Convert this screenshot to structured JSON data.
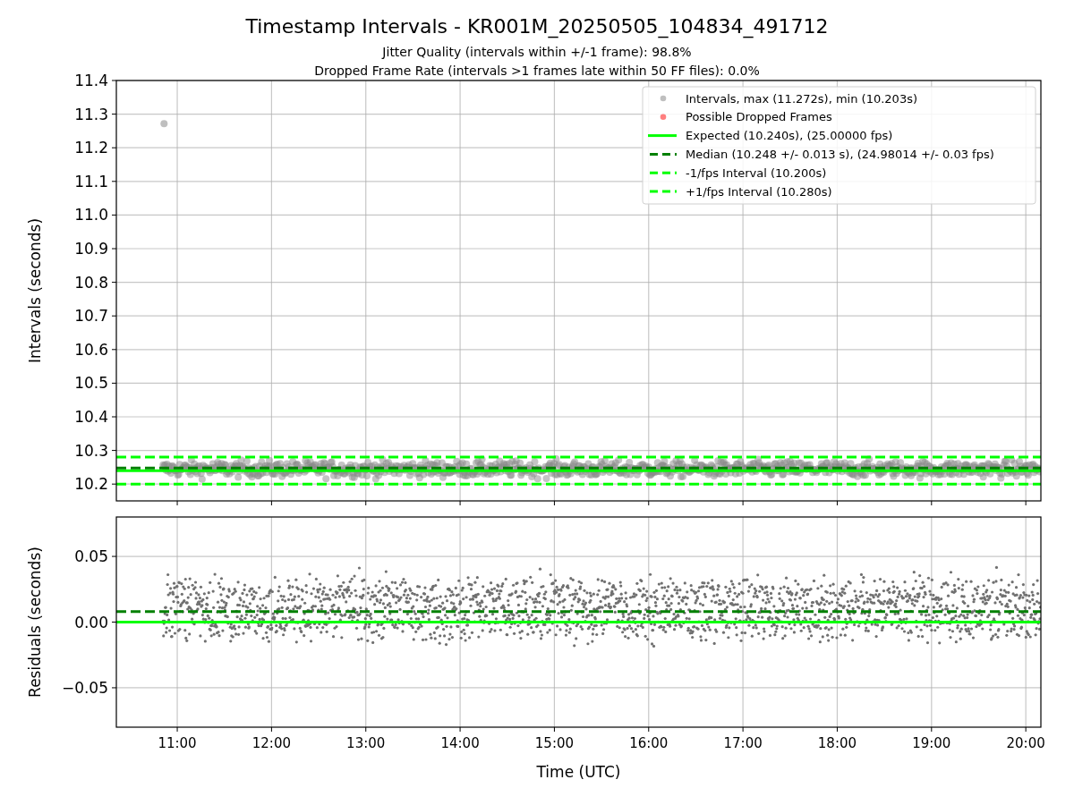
{
  "figure": {
    "title": "Timestamp Intervals - KR001M_20250505_104834_491712",
    "subtitles": [
      "Jitter Quality (intervals within +/-1 frame): 98.8%",
      "Dropped Frame Rate (intervals >1 frames late within 50 FF files): 0.0%"
    ]
  },
  "intervals_plot": {
    "chart_data": {
      "type": "scatter",
      "ylabel": "Intervals (seconds)",
      "grid": true,
      "legend": "upper right",
      "x": [
        10.354,
        10.86,
        20.16
      ],
      "xlim": [
        10.354,
        20.16
      ],
      "ylim": [
        10.15,
        11.4
      ],
      "yticks": [
        {
          "value": 10.2,
          "label": "10.2"
        },
        {
          "value": 10.3,
          "label": "10.3"
        },
        {
          "value": 10.4,
          "label": "10.4"
        },
        {
          "value": 10.5,
          "label": "10.5"
        },
        {
          "value": 10.6,
          "label": "10.6"
        },
        {
          "value": 10.7,
          "label": "10.7"
        },
        {
          "value": 10.8,
          "label": "10.8"
        },
        {
          "value": 10.9,
          "label": "10.9"
        },
        {
          "value": 11,
          "label": "11.0"
        },
        {
          "value": 11.1,
          "label": "11.1"
        },
        {
          "value": 11.2,
          "label": "11.2"
        },
        {
          "value": 11.3,
          "label": "11.3"
        },
        {
          "value": 11.4,
          "label": "11.4"
        }
      ],
      "series": [
        {
          "name": "Intervals, max (11.272s), min (10.203s)",
          "color": "#808080",
          "type": "scatter",
          "values": [
            null,
            11.272,
            null
          ]
        },
        {
          "name": "Possible Dropped Frames",
          "color": "#ff0000",
          "type": "scatter",
          "values": [
            null,
            null,
            null
          ]
        },
        {
          "name": "Expected (10.240s), (25.00000 fps)",
          "color": "#00ff00",
          "type": "line",
          "values": [
            10.24,
            10.24,
            10.24
          ]
        },
        {
          "name": "Median (10.248 +/- 0.013 s), (24.98014 +/- 0.03 fps)",
          "color": "#008000",
          "type": "line",
          "line_style": "dashed",
          "values": [
            10.248,
            10.248,
            10.248
          ]
        },
        {
          "name": "-1/fps Interval (10.200s)",
          "color": "#00ff00",
          "type": "line",
          "line_style": "dashed",
          "values": [
            10.2,
            10.2,
            10.2
          ]
        },
        {
          "name": "+1/fps Interval (10.280s)",
          "color": "#00ff00",
          "type": "line",
          "line_style": "dashed",
          "values": [
            10.28,
            10.28,
            10.28
          ]
        }
      ]
    }
  },
  "residuals_plot": {
    "chart_data": {
      "type": "scatter",
      "xlabel": "Time (UTC)",
      "ylabel": "Residuals (seconds)",
      "grid": true,
      "x": [
        10.354,
        20.16
      ],
      "xlim": [
        10.354,
        20.16
      ],
      "ylim": [
        -0.08,
        0.08
      ],
      "xticks": [
        {
          "value": 11,
          "label": "11:00"
        },
        {
          "value": 12,
          "label": "12:00"
        },
        {
          "value": 13,
          "label": "13:00"
        },
        {
          "value": 14,
          "label": "14:00"
        },
        {
          "value": 15,
          "label": "15:00"
        },
        {
          "value": 16,
          "label": "16:00"
        },
        {
          "value": 17,
          "label": "17:00"
        },
        {
          "value": 18,
          "label": "18:00"
        },
        {
          "value": 19,
          "label": "19:00"
        },
        {
          "value": 20,
          "label": "20:00"
        }
      ],
      "yticks": [
        {
          "value": -0.05,
          "label": "−0.05"
        },
        {
          "value": 0,
          "label": "0.00"
        },
        {
          "value": 0.05,
          "label": "0.05"
        }
      ],
      "series": [
        {
          "color": "#008000",
          "type": "line",
          "line_style": "dashed",
          "values": [
            0.008,
            0.008
          ]
        },
        {
          "color": "#00ff00",
          "type": "line",
          "values": [
            0,
            0
          ]
        }
      ]
    }
  }
}
